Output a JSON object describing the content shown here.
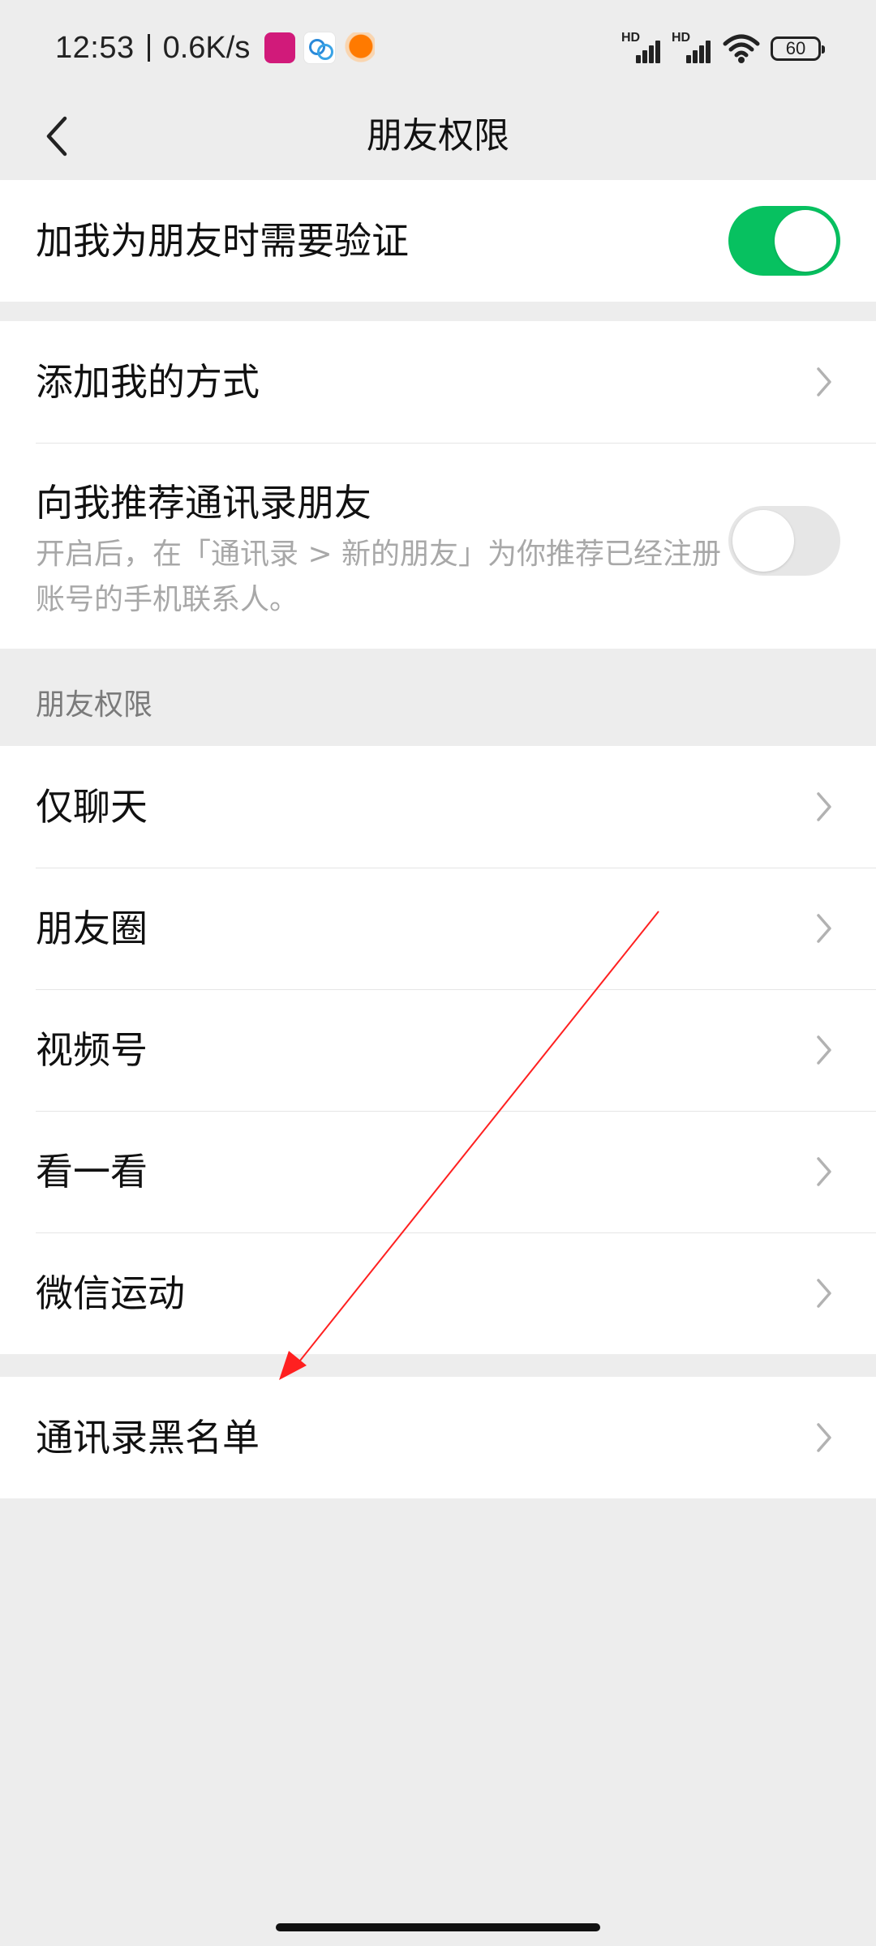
{
  "status_bar": {
    "time": "12:53",
    "speed": "0.6K/s",
    "signal_label_1": "HD",
    "signal_label_2": "HD",
    "battery": "60"
  },
  "header": {
    "title": "朋友权限"
  },
  "section1": {
    "verify_label": "加我为朋友时需要验证",
    "verify_on": true
  },
  "section2": {
    "add_methods_label": "添加我的方式",
    "recommend_title": "向我推荐通讯录朋友",
    "recommend_desc": "开启后，在「通讯录 > 新的朋友」为你推荐已经注册账号的手机联系人。",
    "recommend_on": false
  },
  "group": {
    "header": "朋友权限",
    "items": [
      {
        "label": "仅聊天"
      },
      {
        "label": "朋友圈"
      },
      {
        "label": "视频号"
      },
      {
        "label": "看一看"
      },
      {
        "label": "微信运动"
      }
    ]
  },
  "section3": {
    "blacklist_label": "通讯录黑名单"
  },
  "colors": {
    "accent": "#07c160",
    "annotation": "#ff0000"
  }
}
